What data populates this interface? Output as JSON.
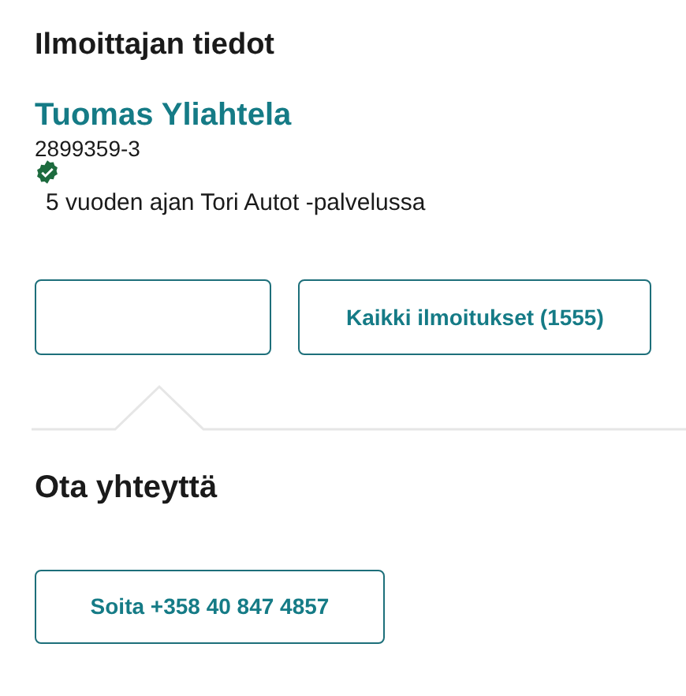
{
  "section_title": "Ilmoittajan tiedot",
  "seller": {
    "name": "Tuomas Yliahtela",
    "business_id": "2899359-3",
    "verified": true,
    "membership": "5 vuoden ajan Tori Autot -palvelussa"
  },
  "buttons": [
    {
      "kind": "blank"
    },
    {
      "kind": "text",
      "label": "Kaikki ilmoitukset (1555)"
    }
  ],
  "contact": {
    "title": "Ota yhteyttä",
    "call_button": "Soita +358 40 847 4857"
  }
}
